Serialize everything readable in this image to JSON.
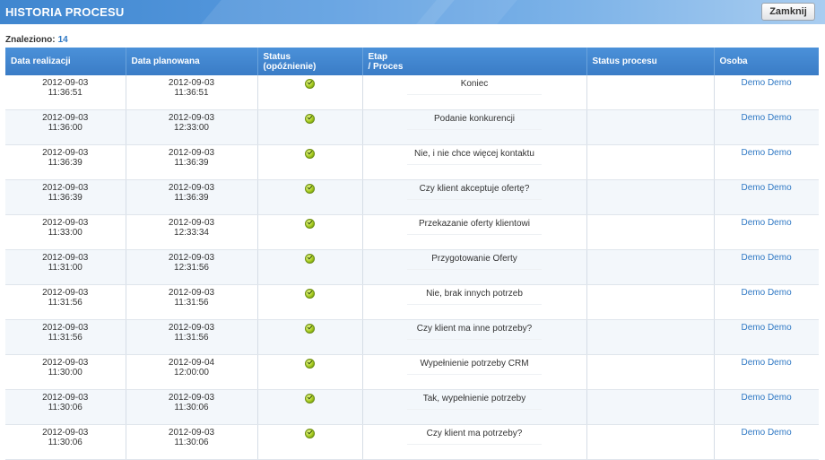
{
  "header": {
    "title": "HISTORIA PROCESU",
    "close_label": "Zamknij"
  },
  "summary": {
    "found_label": "Znaleziono:",
    "found_count": "14"
  },
  "table": {
    "columns": [
      {
        "line1": "Data realizacji",
        "line2": ""
      },
      {
        "line1": "Data planowana",
        "line2": ""
      },
      {
        "line1": "Status",
        "line2": "(opóźnienie)"
      },
      {
        "line1": "Etap",
        "line2": "/ Proces"
      },
      {
        "line1": "Status procesu",
        "line2": ""
      },
      {
        "line1": "Osoba",
        "line2": ""
      }
    ],
    "rows": [
      {
        "real_date": "2012-09-03",
        "real_time": "11:36:51",
        "plan_date": "2012-09-03",
        "plan_time": "11:36:51",
        "status_icon": "check-ok-icon",
        "stage": "Koniec",
        "process_status": "",
        "person": "Demo Demo"
      },
      {
        "real_date": "2012-09-03",
        "real_time": "11:36:00",
        "plan_date": "2012-09-03",
        "plan_time": "12:33:00",
        "status_icon": "check-ok-icon",
        "stage": "Podanie konkurencji",
        "process_status": "",
        "person": "Demo Demo"
      },
      {
        "real_date": "2012-09-03",
        "real_time": "11:36:39",
        "plan_date": "2012-09-03",
        "plan_time": "11:36:39",
        "status_icon": "check-ok-icon",
        "stage": "Nie, i nie chce więcej kontaktu",
        "process_status": "",
        "person": "Demo Demo"
      },
      {
        "real_date": "2012-09-03",
        "real_time": "11:36:39",
        "plan_date": "2012-09-03",
        "plan_time": "11:36:39",
        "status_icon": "check-ok-icon",
        "stage": "Czy klient akceptuje ofertę?",
        "process_status": "",
        "person": "Demo Demo"
      },
      {
        "real_date": "2012-09-03",
        "real_time": "11:33:00",
        "plan_date": "2012-09-03",
        "plan_time": "12:33:34",
        "status_icon": "check-ok-icon",
        "stage": "Przekazanie oferty klientowi",
        "process_status": "",
        "person": "Demo Demo"
      },
      {
        "real_date": "2012-09-03",
        "real_time": "11:31:00",
        "plan_date": "2012-09-03",
        "plan_time": "12:31:56",
        "status_icon": "check-ok-icon",
        "stage": "Przygotowanie Oferty",
        "process_status": "",
        "person": "Demo Demo"
      },
      {
        "real_date": "2012-09-03",
        "real_time": "11:31:56",
        "plan_date": "2012-09-03",
        "plan_time": "11:31:56",
        "status_icon": "check-ok-icon",
        "stage": "Nie, brak innych potrzeb",
        "process_status": "",
        "person": "Demo Demo"
      },
      {
        "real_date": "2012-09-03",
        "real_time": "11:31:56",
        "plan_date": "2012-09-03",
        "plan_time": "11:31:56",
        "status_icon": "check-ok-icon",
        "stage": "Czy klient ma inne potrzeby?",
        "process_status": "",
        "person": "Demo Demo"
      },
      {
        "real_date": "2012-09-03",
        "real_time": "11:30:00",
        "plan_date": "2012-09-04",
        "plan_time": "12:00:00",
        "status_icon": "check-ok-icon",
        "stage": "Wypełnienie potrzeby CRM",
        "process_status": "",
        "person": "Demo Demo"
      },
      {
        "real_date": "2012-09-03",
        "real_time": "11:30:06",
        "plan_date": "2012-09-03",
        "plan_time": "11:30:06",
        "status_icon": "check-ok-icon",
        "stage": "Tak, wypełnienie potrzeby",
        "process_status": "",
        "person": "Demo Demo"
      },
      {
        "real_date": "2012-09-03",
        "real_time": "11:30:06",
        "plan_date": "2012-09-03",
        "plan_time": "11:30:06",
        "status_icon": "check-ok-icon",
        "stage": "Czy klient ma potrzeby?",
        "process_status": "",
        "person": "Demo Demo"
      }
    ]
  }
}
